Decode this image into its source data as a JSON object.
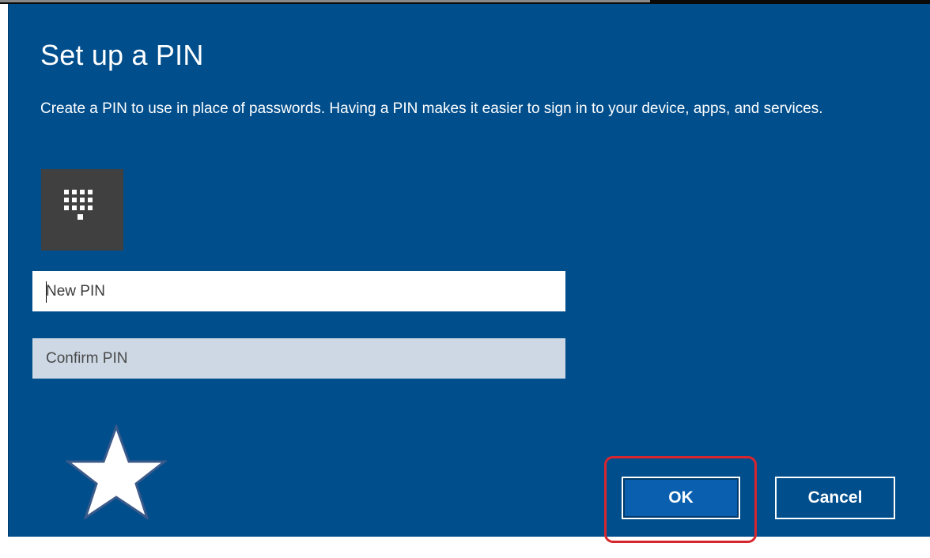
{
  "dialog": {
    "title": "Set up a PIN",
    "description": "Create a PIN to use in place of passwords. Having a PIN makes it easier to sign in to your device, apps, and services.",
    "pin_icon": "keypad-icon",
    "new_pin": {
      "value": "",
      "placeholder": "New PIN"
    },
    "confirm_pin": {
      "value": "",
      "placeholder": "Confirm PIN"
    },
    "buttons": {
      "ok_label": "OK",
      "cancel_label": "Cancel"
    }
  },
  "annotations": {
    "star_icon": "star-icon",
    "highlight": "ok-button-highlight"
  },
  "colors": {
    "dialog_background": "#004e8c",
    "pin_tile": "#404040",
    "confirm_field": "#cdd8e4",
    "ok_button": "#0a5fae",
    "highlight_outline": "#d7262e"
  }
}
